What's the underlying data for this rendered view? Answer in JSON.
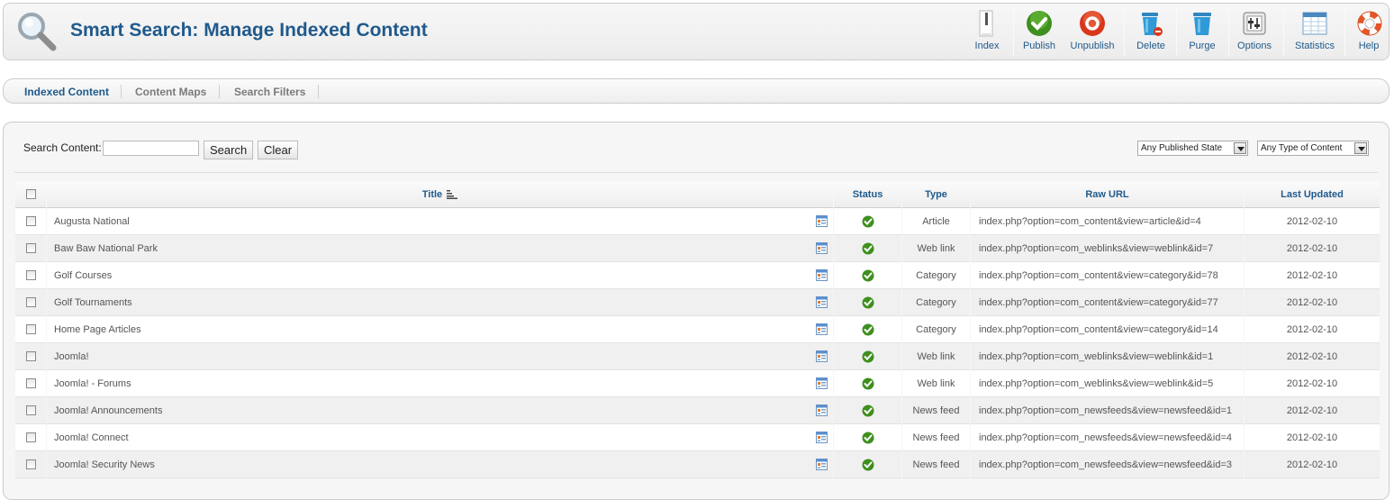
{
  "header": {
    "title": "Smart Search: Manage Indexed Content",
    "title_icon": "magnifier-icon"
  },
  "toolbar": {
    "buttons": [
      {
        "label": "Index",
        "icon": "index-icon"
      },
      {
        "label": "Publish",
        "icon": "publish-icon"
      },
      {
        "label": "Unpublish",
        "icon": "unpublish-icon"
      },
      {
        "label": "Delete",
        "icon": "delete-icon"
      },
      {
        "label": "Purge",
        "icon": "purge-icon"
      },
      {
        "label": "Options",
        "icon": "options-icon"
      },
      {
        "label": "Statistics",
        "icon": "statistics-icon"
      },
      {
        "label": "Help",
        "icon": "help-icon"
      }
    ]
  },
  "submenu": {
    "items": [
      {
        "label": "Indexed Content",
        "active": true
      },
      {
        "label": "Content Maps",
        "active": false
      },
      {
        "label": "Search Filters",
        "active": false
      }
    ]
  },
  "filters": {
    "search_label": "Search Content:",
    "search_value": "",
    "search_button": "Search",
    "clear_button": "Clear",
    "state_select": "Any Published State",
    "type_select": "Any Type of Content"
  },
  "table": {
    "columns": {
      "title": "Title",
      "status": "Status",
      "type": "Type",
      "url": "Raw URL",
      "updated": "Last Updated"
    },
    "rows": [
      {
        "title": "Augusta National",
        "status": "published",
        "type": "Article",
        "url": "index.php?option=com_content&view=article&id=4",
        "updated": "2012-02-10"
      },
      {
        "title": "Baw Baw National Park",
        "status": "published",
        "type": "Web link",
        "url": "index.php?option=com_weblinks&view=weblink&id=7",
        "updated": "2012-02-10"
      },
      {
        "title": "Golf Courses",
        "status": "published",
        "type": "Category",
        "url": "index.php?option=com_content&view=category&id=78",
        "updated": "2012-02-10"
      },
      {
        "title": "Golf Tournaments",
        "status": "published",
        "type": "Category",
        "url": "index.php?option=com_content&view=category&id=77",
        "updated": "2012-02-10"
      },
      {
        "title": "Home Page Articles",
        "status": "published",
        "type": "Category",
        "url": "index.php?option=com_content&view=category&id=14",
        "updated": "2012-02-10"
      },
      {
        "title": "Joomla!",
        "status": "published",
        "type": "Web link",
        "url": "index.php?option=com_weblinks&view=weblink&id=1",
        "updated": "2012-02-10"
      },
      {
        "title": "Joomla! - Forums",
        "status": "published",
        "type": "Web link",
        "url": "index.php?option=com_weblinks&view=weblink&id=5",
        "updated": "2012-02-10"
      },
      {
        "title": "Joomla! Announcements",
        "status": "published",
        "type": "News feed",
        "url": "index.php?option=com_newsfeeds&view=newsfeed&id=1",
        "updated": "2012-02-10"
      },
      {
        "title": "Joomla! Connect",
        "status": "published",
        "type": "News feed",
        "url": "index.php?option=com_newsfeeds&view=newsfeed&id=4",
        "updated": "2012-02-10"
      },
      {
        "title": "Joomla! Security News",
        "status": "published",
        "type": "News feed",
        "url": "index.php?option=com_newsfeeds&view=newsfeed&id=3",
        "updated": "2012-02-10"
      }
    ]
  },
  "colors": {
    "accent": "#1f5a8c",
    "publish_green": "#3e8f1e",
    "unpublish_red": "#d9361c",
    "trash_blue": "#2f9ad6"
  }
}
